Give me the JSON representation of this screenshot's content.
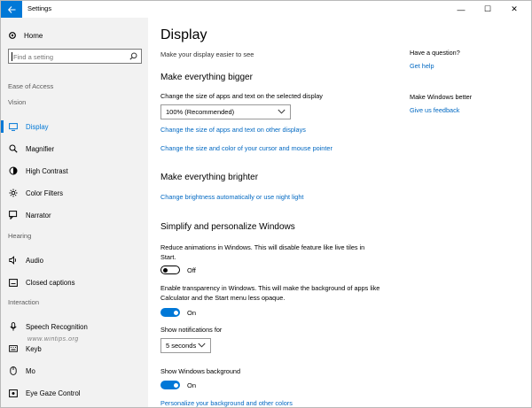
{
  "window": {
    "title": "Settings",
    "controls": {
      "minimize": "—",
      "maximize": "☐",
      "close": "✕"
    }
  },
  "sidebar": {
    "home": "Home",
    "search_placeholder": "Find a setting",
    "category": "Ease of Access",
    "groups": {
      "vision": "Vision",
      "hearing": "Hearing",
      "interaction": "Interaction"
    },
    "items": [
      {
        "label": "Display",
        "icon": "monitor-icon",
        "selected": true
      },
      {
        "label": "Magnifier",
        "icon": "magnifier-icon"
      },
      {
        "label": "High Contrast",
        "icon": "contrast-icon"
      },
      {
        "label": "Color Filters",
        "icon": "color-filter-icon"
      },
      {
        "label": "Narrator",
        "icon": "narrator-icon"
      },
      {
        "label": "Audio",
        "icon": "speaker-icon"
      },
      {
        "label": "Closed captions",
        "icon": "captions-icon"
      },
      {
        "label": "Speech Recognition",
        "icon": "microphone-icon"
      },
      {
        "label": "Keyb",
        "icon": "keyboard-icon"
      },
      {
        "label": "Mo",
        "icon": "mouse-icon"
      },
      {
        "label": "Eye Gaze Control",
        "icon": "eye-icon"
      }
    ],
    "watermark": "www.wintips.org"
  },
  "main": {
    "title": "Display",
    "subtitle": "Make your display easier to see",
    "bigger": {
      "heading": "Make everything bigger",
      "size_label": "Change the size of apps and text on the selected display",
      "size_value": "100% (Recommended)",
      "link_other_displays": "Change the size of apps and text on other displays",
      "link_cursor": "Change the size and color of your cursor and mouse pointer"
    },
    "brighter": {
      "heading": "Make everything brighter",
      "link_brightness": "Change brightness automatically or use night light"
    },
    "simplify": {
      "heading": "Simplify and personalize Windows",
      "animations_label": "Reduce animations in Windows.  This will disable feature like live tiles in Start.",
      "animations_state": "Off",
      "transparency_label": "Enable transparency in Windows.  This will make the background of apps like Calculator and the Start menu less opaque.",
      "transparency_state": "On",
      "notifications_label": "Show notifications for",
      "notifications_value": "5 seconds",
      "background_label": "Show Windows background",
      "background_state": "On",
      "link_personalize": "Personalize your background and other colors"
    }
  },
  "right": {
    "question": "Have a question?",
    "get_help": "Get help",
    "better": "Make Windows better",
    "feedback": "Give us feedback"
  },
  "colors": {
    "accent": "#0078d7",
    "link": "#0068c2",
    "sidebar_bg": "#f2f2f2"
  }
}
